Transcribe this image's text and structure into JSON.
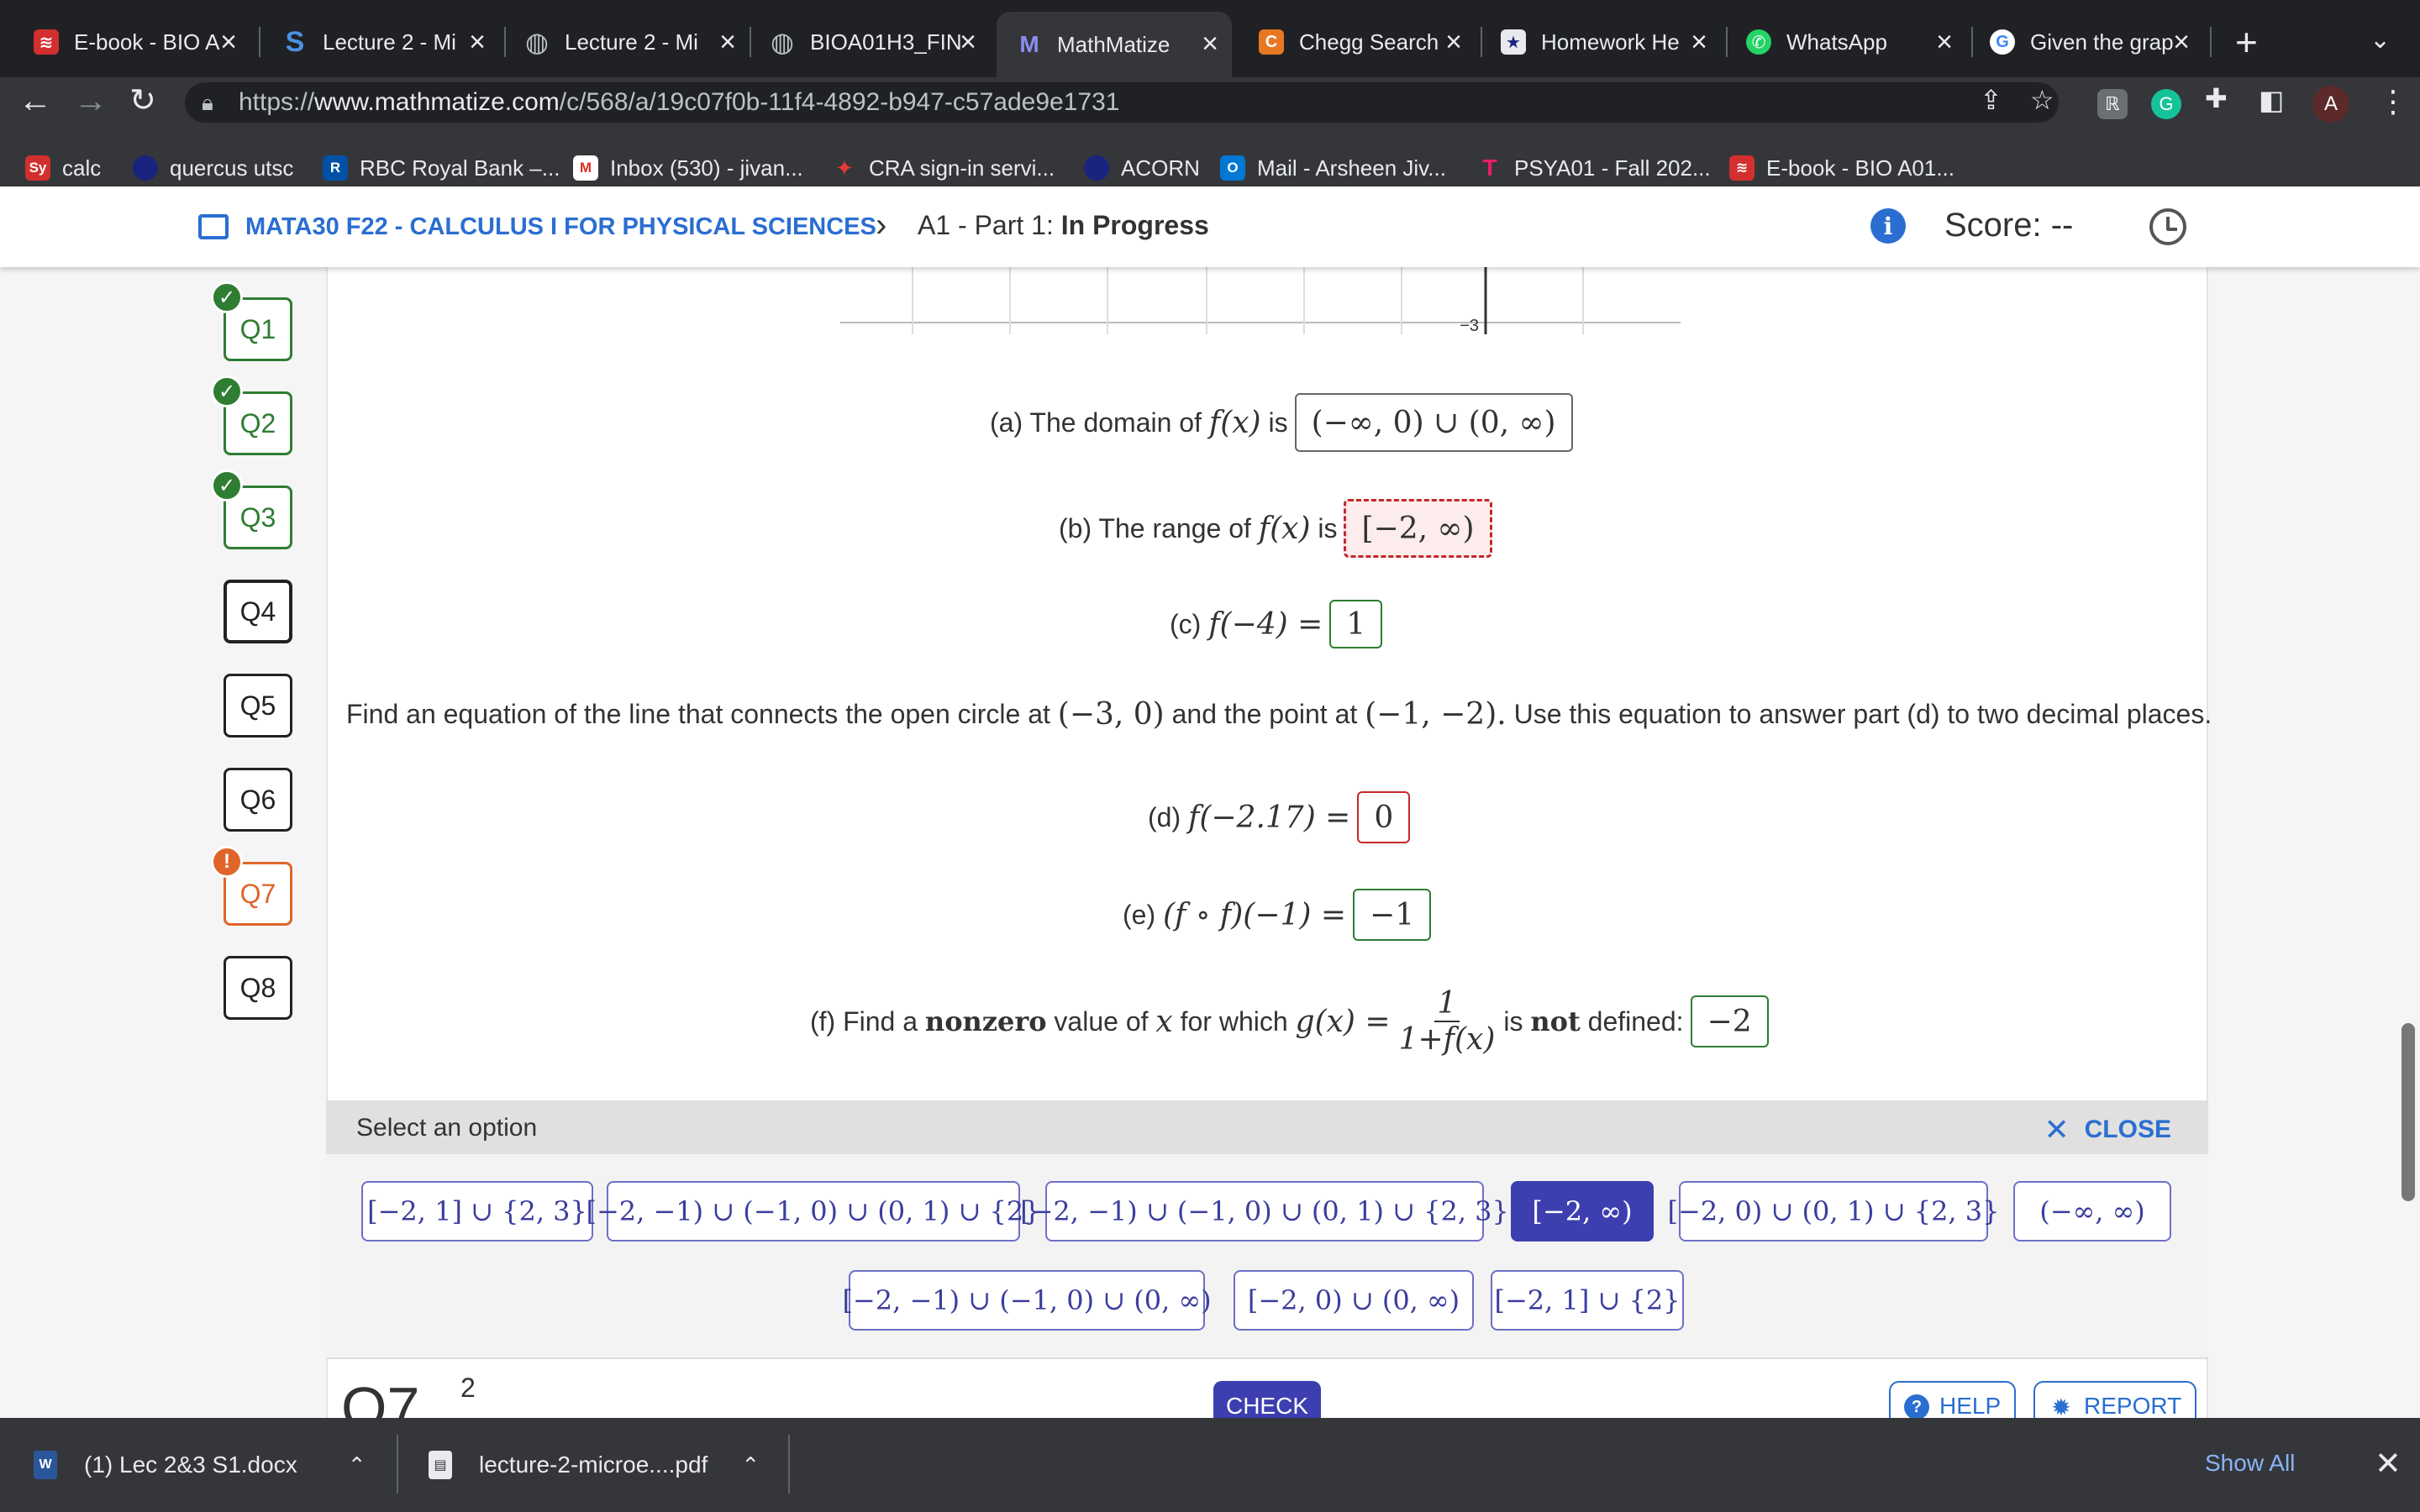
{
  "browser": {
    "tabs": [
      {
        "title": "E-book - BIO A",
        "icon": "mcgraw-icon",
        "color": "#d32f2f",
        "glyph": "≋"
      },
      {
        "title": "Lecture 2 - Mi",
        "icon": "s-logo-icon",
        "color": "#1e88e5",
        "glyph": "S"
      },
      {
        "title": "Lecture 2 - Mi",
        "icon": "globe-icon",
        "color": "#5f6368",
        "glyph": "◍"
      },
      {
        "title": "BIOA01H3_FIN",
        "icon": "globe-icon",
        "color": "#5f6368",
        "glyph": "◍"
      },
      {
        "title": "MathMatize",
        "icon": "mathmatize-icon",
        "color": "#3d3fb0",
        "glyph": "M"
      },
      {
        "title": "Chegg Search",
        "icon": "chegg-icon",
        "color": "#e87722",
        "glyph": "C"
      },
      {
        "title": "Homework He",
        "icon": "star-icon",
        "color": "#1a237e",
        "glyph": "★"
      },
      {
        "title": "WhatsApp",
        "icon": "whatsapp-icon",
        "color": "#25d366",
        "glyph": "✆"
      },
      {
        "title": "Given the grap",
        "icon": "google-icon",
        "color": "#ffffff",
        "glyph": "G"
      }
    ],
    "active_tab": 4,
    "url_prefix": "https://",
    "url_host": "www.mathmatize.com",
    "url_path": "/c/568/a/19c07f0b-11f4-4892-b947-c57ade9e1731",
    "avatar_letter": "A",
    "bookmarks": [
      {
        "label": "calc",
        "icon": "sy-icon",
        "color": "#d32f2f",
        "glyph": "Sy"
      },
      {
        "label": "quercus utsc",
        "icon": "quercus-icon",
        "color": "#1a237e",
        "glyph": ""
      },
      {
        "label": "RBC Royal Bank –...",
        "icon": "rbc-icon",
        "color": "#0051a5",
        "glyph": "R"
      },
      {
        "label": "Inbox (530) - jivan...",
        "icon": "gmail-icon",
        "color": "#d93025",
        "glyph": "M"
      },
      {
        "label": "CRA sign-in servi...",
        "icon": "maple-leaf-icon",
        "color": "#d32f2f",
        "glyph": "✦"
      },
      {
        "label": "ACORN",
        "icon": "acorn-icon",
        "color": "#1a237e",
        "glyph": ""
      },
      {
        "label": "Mail - Arsheen Jiv...",
        "icon": "outlook-icon",
        "color": "#0078d4",
        "glyph": "O"
      },
      {
        "label": "PSYA01 - Fall 202...",
        "icon": "tophat-icon",
        "color": "#c2185b",
        "glyph": "T"
      },
      {
        "label": "E-book - BIO A01...",
        "icon": "mcgraw-icon",
        "color": "#d32f2f",
        "glyph": "≋"
      }
    ]
  },
  "header": {
    "course": "MATA30 F22 - CALCULUS I FOR PHYSICAL SCIENCES",
    "crumb_prefix": "A1 - Part 1:",
    "crumb_status": "In Progress",
    "score_label": "Score: --"
  },
  "questions": [
    {
      "label": "Q1",
      "state": "correct"
    },
    {
      "label": "Q2",
      "state": "correct"
    },
    {
      "label": "Q3",
      "state": "correct"
    },
    {
      "label": "Q4",
      "state": "current"
    },
    {
      "label": "Q5",
      "state": "none"
    },
    {
      "label": "Q6",
      "state": "none"
    },
    {
      "label": "Q7",
      "state": "warning"
    },
    {
      "label": "Q8",
      "state": "none"
    }
  ],
  "graph": {
    "tick_label": "−3"
  },
  "parts": {
    "a": {
      "prefix": "(a) The domain of",
      "expr": "f(x)",
      "mid": "is",
      "answer": "(−∞, 0) ∪ (0, ∞)"
    },
    "b": {
      "prefix": "(b) The range of",
      "expr": "f(x)",
      "mid": "is",
      "answer": "[−2, ∞)"
    },
    "c": {
      "prefix": "(c)",
      "expr": "f(−4) =",
      "answer": "1"
    },
    "instruction": {
      "t1": "Find an equation of the line that connects the open circle at",
      "m1": "(−3, 0)",
      "t2": "and the point at",
      "m2": "(−1, −2).",
      "t3": "Use this equation to answer part (d) to two decimal places."
    },
    "d": {
      "prefix": "(d)",
      "expr": "f(−2.17) =",
      "answer": "0"
    },
    "e": {
      "prefix": "(e)",
      "expr": "(f ∘ f)(−1) =",
      "answer": "−1"
    },
    "f": {
      "t1": "(f) Find a",
      "bold1": "nonzero",
      "t2": "value of",
      "var": "x",
      "t3": "for which",
      "expr": "g(x) =",
      "num": "1",
      "den": "1+f(x)",
      "t4": "is",
      "bold2": "not",
      "t5": "defined:",
      "answer": "−2"
    }
  },
  "options_panel": {
    "title": "Select an option",
    "close_label": "CLOSE",
    "options": [
      "[−2, 1] ∪ {2, 3}",
      "[−2, −1) ∪ (−1, 0) ∪ (0, 1) ∪ {2}",
      "[−2, −1) ∪ (−1, 0) ∪ (0, 1) ∪ {2, 3}",
      "[−2, ∞)",
      "[−2, 0) ∪ (0, 1) ∪ {2, 3}",
      "(−∞, ∞)",
      "[−2, −1) ∪ (−1, 0) ∪ (0, ∞)",
      "[−2, 0) ∪ (0, ∞)",
      "[−2, 1] ∪ {2}"
    ],
    "selected": 3
  },
  "footer": {
    "q_label": "Q7",
    "q_sup": "2",
    "check_label": "CHECK",
    "help_label": "HELP",
    "report_label": "REPORT"
  },
  "downloads": {
    "items": [
      {
        "name": "(1) Lec 2&3 S1.docx",
        "icon": "word-doc-icon",
        "color": "#2b579a",
        "glyph": "W"
      },
      {
        "name": "lecture-2-microe....pdf",
        "icon": "pdf-file-icon",
        "color": "#e8eaed",
        "glyph": ""
      }
    ],
    "show_all": "Show All"
  }
}
